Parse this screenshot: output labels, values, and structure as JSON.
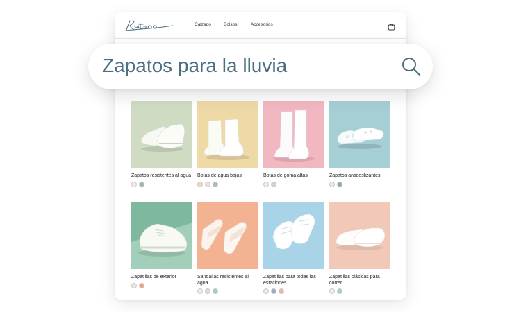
{
  "brand": {
    "logo_text": "Kutsoo"
  },
  "nav": {
    "items": [
      "Calzado",
      "Bolsos",
      "Accesorios"
    ]
  },
  "header": {
    "cart_icon": "bag-icon"
  },
  "search": {
    "query": "Zapatos para la lluvia",
    "icon": "search-icon"
  },
  "accent_color": "#4a6f82",
  "products": [
    {
      "name": "Zapatos resistentes al agua",
      "background": "#cfdcc3",
      "swatches": [
        "#f3eeea",
        "#9fb3bd"
      ]
    },
    {
      "name": "Botas de agua bajas",
      "background": "#efd9a7",
      "swatches": [
        "#f6d6b8",
        "#f4ddd4",
        "#a9bcc4"
      ]
    },
    {
      "name": "Botas de goma altas",
      "background": "#f2b8c2",
      "swatches": [
        "#f0eceb",
        "#c8d6dc"
      ]
    },
    {
      "name": "Zapatos antideslizantes",
      "background": "#a6cfd5",
      "swatches": [
        "#eeeae6",
        "#8fa7b1"
      ]
    },
    {
      "name": "Zapatillas de exterior",
      "background": "#a2cfb9",
      "swatches": [
        "#f6e4dc",
        "#f0a47d"
      ]
    },
    {
      "name": "Sandalias resistentes al agua",
      "background": "#f3b393",
      "swatches": [
        "#f4eee9",
        "#cde3d6",
        "#9fc9d4"
      ]
    },
    {
      "name": "Zapatillas para todas las estaciones",
      "background": "#a9d3e6",
      "swatches": [
        "#eeeae6",
        "#8fb1c0",
        "#f3b2b2"
      ]
    },
    {
      "name": "Zapatillas clásicas para correr",
      "background": "#f2c9b8",
      "swatches": [
        "#f1ece8",
        "#a8cdd9"
      ]
    }
  ]
}
